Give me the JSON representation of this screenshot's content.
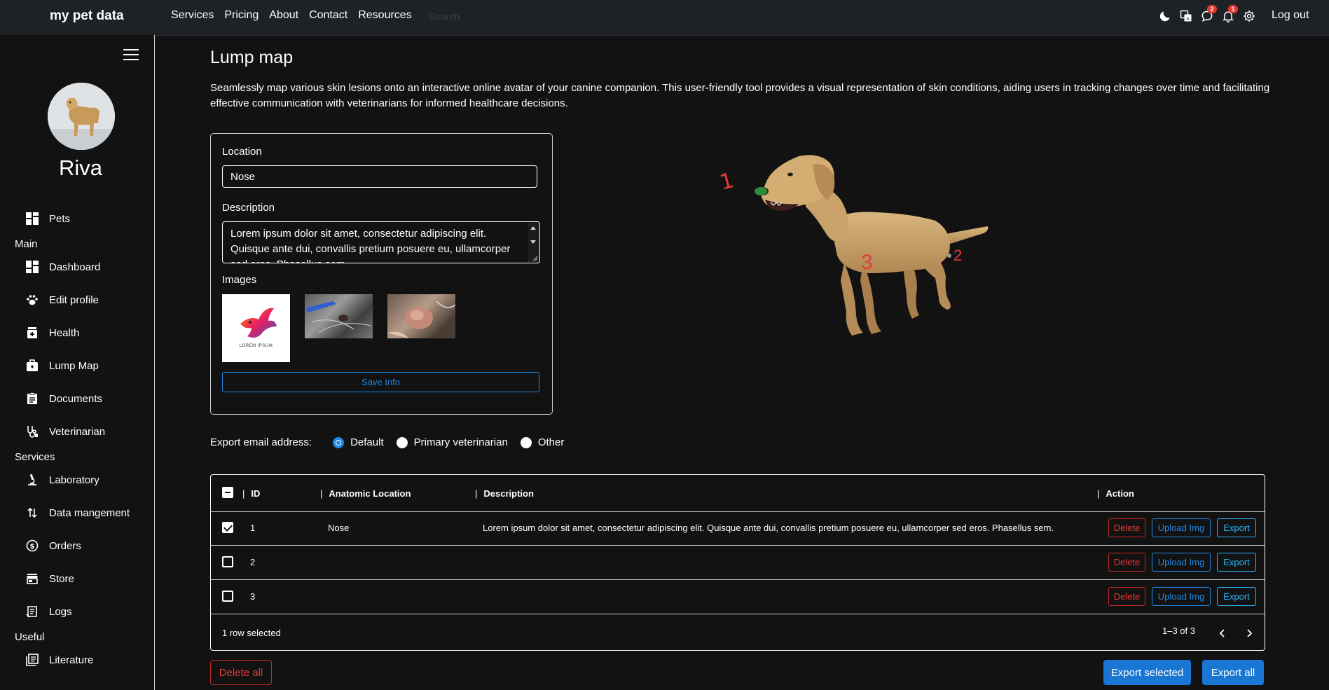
{
  "app": {
    "brand": "my pet data"
  },
  "nav": {
    "items": [
      "Services",
      "Pricing",
      "About",
      "Contact",
      "Resources"
    ]
  },
  "search": {
    "placeholder": "Search"
  },
  "header": {
    "icons": [
      "moon-icon",
      "translate-icon",
      "chat-icon",
      "bell-icon",
      "gear-icon"
    ],
    "chat_badge": "2",
    "bell_badge": "1",
    "logout_label": "Log out"
  },
  "sidebar": {
    "pet_name": "Riva",
    "pets_label": "Pets",
    "section_main": "Main",
    "main_items": [
      "Dashboard",
      "Edit profile",
      "Health",
      "Lump Map",
      "Documents",
      "Veterinarian"
    ],
    "section_services": "Services",
    "services_items": [
      "Laboratory",
      "Data mangement",
      "Orders",
      "Store",
      "Logs"
    ],
    "section_useful": "Useful",
    "useful_items": [
      "Literature"
    ]
  },
  "page": {
    "title": "Lump map",
    "intro": "Seamlessly map various skin lesions onto an interactive online avatar of your canine companion. This user-friendly tool provides a visual representation of skin conditions, aiding users in tracking changes over time and facilitating effective communication with veterinarians for informed healthcare decisions."
  },
  "form": {
    "location_label": "Location",
    "location_value": "Nose",
    "description_label": "Description",
    "description_value": "Lorem ipsum dolor sit amet, consectetur adipiscing elit. Quisque ante dui, convallis pretium posuere eu, ullamcorper sed eros. Phasellus sem.",
    "images_label": "Images",
    "logo_text": "LOREM IPSUM",
    "save_label": "Save Info"
  },
  "dog_markers": [
    "1",
    "2",
    "3"
  ],
  "export": {
    "label": "Export email address:",
    "options": [
      "Default",
      "Primary veterinarian",
      "Other"
    ],
    "selected": "Default"
  },
  "table": {
    "columns": [
      "ID",
      "Anatomic Location",
      "Description",
      "Action"
    ],
    "rows": [
      {
        "id": "1",
        "location": "Nose",
        "description": "Lorem ipsum dolor sit amet, consectetur adipiscing elit. Quisque ante dui, convallis pretium posuere eu, ullamcorper sed eros. Phasellus sem.",
        "checked": true
      },
      {
        "id": "2",
        "location": "",
        "description": "",
        "checked": false
      },
      {
        "id": "3",
        "location": "",
        "description": "",
        "checked": false
      }
    ],
    "actions": {
      "delete": "Delete",
      "upload": "Upload Img",
      "export": "Export"
    },
    "footer_selected": "1 row selected",
    "pagination": "1–3 of 3"
  },
  "bottom": {
    "delete_all": "Delete all",
    "export_selected": "Export selected",
    "export_all": "Export all"
  },
  "colors": {
    "accent": "#1976d2",
    "danger": "#e53935",
    "info": "#29b6f6",
    "background": "#121212",
    "topbar": "#1e2126"
  }
}
